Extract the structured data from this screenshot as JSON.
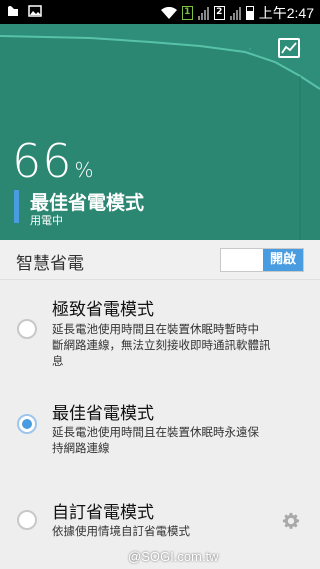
{
  "status_bar": {
    "sim1": "1",
    "sim2": "2",
    "time": "上午2:47",
    "icons": [
      "app-icon",
      "image-icon",
      "wifi-icon",
      "signal-icon",
      "battery-icon"
    ]
  },
  "hero": {
    "percent_value": "66",
    "percent_unit": "%",
    "mode_title": "最佳省電模式",
    "mode_subtitle": "用電中",
    "graph_icon": "chart-icon",
    "colors": {
      "background": "#2f8e79",
      "accent": "#4a9ce0"
    }
  },
  "smart_saving": {
    "label": "智慧省電",
    "toggle_label": "開啟"
  },
  "modes": [
    {
      "title": "極致省電模式",
      "desc_lines": [
        "延長電池使用時間且在裝置休眠時暫時中",
        "斷網路連線，無法立刻接收即時通訊軟體訊",
        "息"
      ],
      "selected": false
    },
    {
      "title": "最佳省電模式",
      "desc_lines": [
        "延長電池使用時間且在裝置休眠時永遠保",
        "持網路連線"
      ],
      "selected": true
    },
    {
      "title": "自訂省電模式",
      "desc_lines": [
        "依據使用情境自訂省電模式"
      ],
      "selected": false,
      "settings_icon": "gear-icon"
    }
  ],
  "watermark": "@SOGI.com.tw"
}
